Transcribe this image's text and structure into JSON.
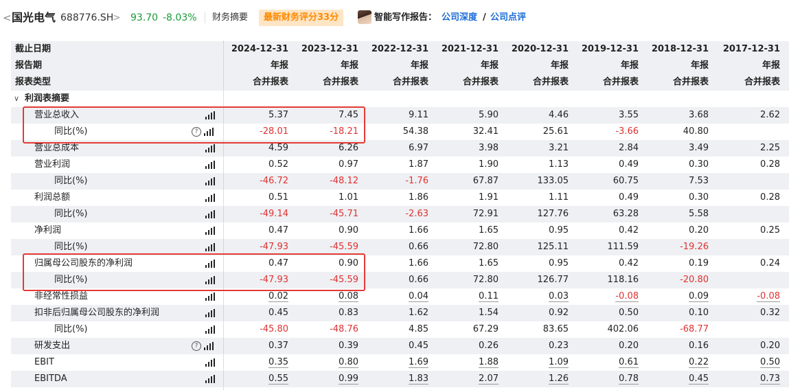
{
  "header": {
    "back_glyph": "<",
    "stock_name": "国光电气",
    "stock_code": "688776.SH",
    "chevron": ">",
    "price": "93.70",
    "change": "-8.03%",
    "section": "财务摘要",
    "badge": "最新财务评分33分",
    "ai_label": "智能写作报告：",
    "link_depth": "公司深度",
    "slash": "/",
    "link_review": "公司点评",
    "colors": {
      "green": "#1a9a3a",
      "red": "#e03131",
      "link": "#1a6bd6",
      "badge": "#ff8a00"
    }
  },
  "table": {
    "header_labels": [
      "截止日期",
      "报告期",
      "报表类型"
    ],
    "dates": [
      "2024-12-31",
      "2023-12-31",
      "2022-12-31",
      "2021-12-31",
      "2020-12-31",
      "2019-12-31",
      "2018-12-31",
      "2017-12-31"
    ],
    "periods": [
      "年报",
      "年报",
      "年报",
      "年报",
      "年报",
      "年报",
      "年报",
      "年报"
    ],
    "types": [
      "合并报表",
      "合并报表",
      "合并报表",
      "合并报表",
      "合并报表",
      "合并报表",
      "合并报表",
      "合并报表"
    ],
    "section_title": "利润表摘要",
    "section_chevron": "∨",
    "rows": [
      {
        "label": "营业总收入",
        "indent": 1,
        "help": false,
        "underline": false,
        "values": [
          "5.37",
          "7.45",
          "9.11",
          "5.90",
          "4.46",
          "3.55",
          "3.68",
          "2.62"
        ]
      },
      {
        "label": "同比(%)",
        "indent": 2,
        "help": true,
        "underline": false,
        "values": [
          "-28.01",
          "-18.21",
          "54.38",
          "32.41",
          "25.61",
          "-3.66",
          "40.80",
          ""
        ]
      },
      {
        "label": "营业总成本",
        "indent": 1,
        "help": false,
        "underline": false,
        "values": [
          "4.59",
          "6.26",
          "6.97",
          "3.98",
          "3.21",
          "2.84",
          "3.49",
          "2.25"
        ]
      },
      {
        "label": "营业利润",
        "indent": 1,
        "help": false,
        "underline": false,
        "values": [
          "0.52",
          "0.97",
          "1.87",
          "1.90",
          "1.13",
          "0.49",
          "0.30",
          "0.28"
        ]
      },
      {
        "label": "同比(%)",
        "indent": 2,
        "help": false,
        "underline": false,
        "values": [
          "-46.72",
          "-48.12",
          "-1.76",
          "67.87",
          "133.05",
          "60.75",
          "7.53",
          ""
        ]
      },
      {
        "label": "利润总额",
        "indent": 1,
        "help": false,
        "underline": false,
        "values": [
          "0.51",
          "1.01",
          "1.86",
          "1.91",
          "1.11",
          "0.49",
          "0.30",
          "0.28"
        ]
      },
      {
        "label": "同比(%)",
        "indent": 2,
        "help": false,
        "underline": false,
        "values": [
          "-49.14",
          "-45.71",
          "-2.63",
          "72.91",
          "127.76",
          "63.28",
          "5.58",
          ""
        ]
      },
      {
        "label": "净利润",
        "indent": 1,
        "help": false,
        "underline": false,
        "values": [
          "0.47",
          "0.90",
          "1.66",
          "1.65",
          "0.95",
          "0.42",
          "0.20",
          "0.25"
        ]
      },
      {
        "label": "同比(%)",
        "indent": 2,
        "help": false,
        "underline": false,
        "values": [
          "-47.93",
          "-45.59",
          "0.66",
          "72.80",
          "125.11",
          "111.59",
          "-19.26",
          ""
        ]
      },
      {
        "label": "归属母公司股东的净利润",
        "indent": 1,
        "help": false,
        "underline": false,
        "values": [
          "0.47",
          "0.90",
          "1.66",
          "1.65",
          "0.95",
          "0.42",
          "0.19",
          "0.24"
        ]
      },
      {
        "label": "同比(%)",
        "indent": 2,
        "help": false,
        "underline": false,
        "values": [
          "-47.93",
          "-45.59",
          "0.66",
          "72.80",
          "126.77",
          "118.16",
          "-20.80",
          ""
        ]
      },
      {
        "label": "非经常性损益",
        "indent": 1,
        "help": false,
        "underline": true,
        "values": [
          "0.02",
          "0.08",
          "0.04",
          "0.11",
          "0.03",
          "-0.08",
          "0.09",
          "-0.08"
        ]
      },
      {
        "label": "扣非后归属母公司股东的净利润",
        "indent": 1,
        "help": false,
        "underline": false,
        "values": [
          "0.45",
          "0.83",
          "1.62",
          "1.54",
          "0.92",
          "0.50",
          "0.10",
          "0.32"
        ]
      },
      {
        "label": "同比(%)",
        "indent": 2,
        "help": false,
        "underline": false,
        "values": [
          "-45.80",
          "-48.76",
          "4.85",
          "67.29",
          "83.65",
          "402.06",
          "-68.77",
          ""
        ]
      },
      {
        "label": "研发支出",
        "indent": 1,
        "help": true,
        "underline": false,
        "values": [
          "0.37",
          "0.39",
          "0.45",
          "0.26",
          "0.23",
          "0.20",
          "0.16",
          "0.20"
        ]
      },
      {
        "label": "EBIT",
        "indent": 1,
        "help": false,
        "underline": true,
        "values": [
          "0.35",
          "0.80",
          "1.69",
          "1.88",
          "1.09",
          "0.61",
          "0.22",
          "0.50"
        ]
      },
      {
        "label": "EBITDA",
        "indent": 1,
        "help": false,
        "underline": true,
        "values": [
          "0.55",
          "0.99",
          "1.83",
          "2.07",
          "1.26",
          "0.78",
          "0.45",
          "0.73"
        ]
      }
    ]
  },
  "icons": {
    "help_glyph": "?",
    "chart_icon": "bar-chart-icon",
    "help_icon": "help-icon"
  }
}
